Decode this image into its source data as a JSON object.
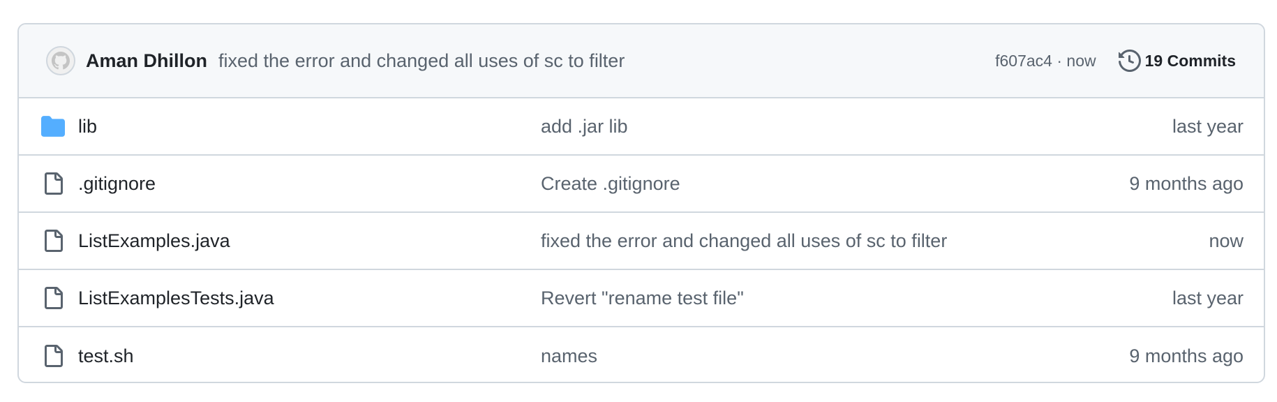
{
  "commit": {
    "author": "Aman Dhillon",
    "message": "fixed the error and changed all uses of sc to filter",
    "sha": "f607ac4",
    "separator": "·",
    "time": "now",
    "commits_label": "19 Commits"
  },
  "files": [
    {
      "name": "lib",
      "type": "folder",
      "icon": "folder-icon",
      "message": "add .jar lib",
      "time": "last year"
    },
    {
      "name": ".gitignore",
      "type": "file",
      "icon": "file-icon",
      "message": "Create .gitignore",
      "time": "9 months ago"
    },
    {
      "name": "ListExamples.java",
      "type": "file",
      "icon": "file-icon",
      "message": "fixed the error and changed all uses of sc to filter",
      "time": "now"
    },
    {
      "name": "ListExamplesTests.java",
      "type": "file",
      "icon": "file-icon",
      "message": "Revert \"rename test file\"",
      "time": "last year"
    },
    {
      "name": "test.sh",
      "type": "file",
      "icon": "file-icon",
      "message": "names",
      "time": "9 months ago"
    }
  ],
  "colors": {
    "folder": "#54aeff",
    "border": "#d0d7de",
    "header_bg": "#f6f8fa",
    "muted_text": "#59636e"
  }
}
